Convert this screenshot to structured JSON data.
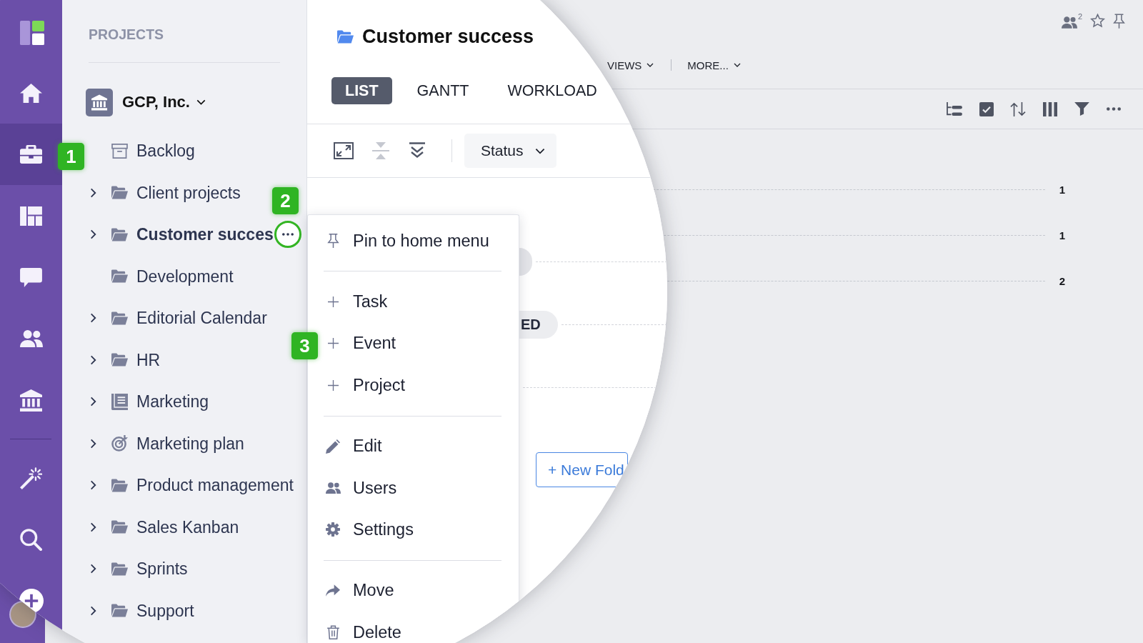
{
  "sidebar": {
    "items": [
      {
        "kind": "home",
        "selected": false
      },
      {
        "kind": "projects",
        "selected": true,
        "callout": "1"
      },
      {
        "kind": "dashboards",
        "selected": false
      },
      {
        "kind": "inbox",
        "selected": false
      },
      {
        "kind": "users",
        "selected": false
      },
      {
        "kind": "accounts",
        "selected": false
      }
    ],
    "tools": [
      {
        "kind": "wand",
        "selected": false
      },
      {
        "kind": "search",
        "selected": false
      },
      {
        "kind": "create",
        "selected": false
      }
    ]
  },
  "projects": {
    "title": "PROJECTS",
    "account": {
      "name": "GCP, Inc."
    },
    "items": [
      {
        "label": "Backlog",
        "kind": "box",
        "has_children": false,
        "selected": false
      },
      {
        "label": "Client projects",
        "kind": "folder",
        "has_children": true,
        "selected": false
      },
      {
        "label": "Customer succes",
        "kind": "folder",
        "has_children": true,
        "selected": true,
        "more_button": {
          "highlighted": true,
          "callout": "2"
        }
      },
      {
        "label": "Development",
        "kind": "folder",
        "has_children": false,
        "selected": false
      },
      {
        "label": "Editorial Calendar",
        "kind": "folder",
        "has_children": true,
        "selected": false
      },
      {
        "label": "HR",
        "kind": "folder",
        "has_children": true,
        "selected": false
      },
      {
        "label": "Marketing",
        "kind": "sheet",
        "has_children": true,
        "selected": false
      },
      {
        "label": "Marketing plan",
        "kind": "target",
        "has_children": true,
        "selected": false
      },
      {
        "label": "Product management",
        "kind": "folder",
        "has_children": true,
        "selected": false
      },
      {
        "label": "Sales Kanban",
        "kind": "folder",
        "has_children": true,
        "selected": false
      },
      {
        "label": "Sprints",
        "kind": "folder",
        "has_children": true,
        "selected": false
      },
      {
        "label": "Support",
        "kind": "folder",
        "has_children": true,
        "selected": false
      }
    ]
  },
  "content": {
    "title": "Customer success",
    "tabs": [
      {
        "label": "LIST",
        "selected": true
      },
      {
        "label": "GANTT",
        "selected": false
      },
      {
        "label": "WORKLOAD",
        "selected": false
      }
    ],
    "tools": [
      {
        "kind": "expand",
        "disabled": false
      },
      {
        "kind": "collapse",
        "disabled": true
      },
      {
        "kind": "expand_all",
        "disabled": false
      }
    ],
    "group_by": {
      "label": "Status"
    },
    "groups": [
      {
        "kind": "pill"
      },
      {
        "kind": "pill",
        "label": "ED"
      },
      {
        "kind": "line"
      }
    ],
    "new_folder_button": {
      "label": "+ New Fold"
    }
  },
  "context_menu": {
    "sections": [
      [
        {
          "kind": "pin",
          "label": "Pin to home menu"
        }
      ],
      [
        {
          "kind": "plus",
          "label": "Task"
        },
        {
          "kind": "plus",
          "label": "Event",
          "callout": "3"
        },
        {
          "kind": "plus",
          "label": "Project"
        }
      ],
      [
        {
          "kind": "pencil",
          "label": "Edit"
        },
        {
          "kind": "users",
          "label": "Users"
        },
        {
          "kind": "gear",
          "label": "Settings"
        }
      ],
      [
        {
          "kind": "move",
          "label": "Move"
        },
        {
          "kind": "trash",
          "label": "Delete"
        }
      ]
    ]
  },
  "background": {
    "header_actions": [
      {
        "kind": "members",
        "count": "2"
      },
      {
        "kind": "star"
      },
      {
        "kind": "pin"
      }
    ],
    "menus": [
      {
        "label": "VIEWS"
      },
      {
        "label": "MORE..."
      }
    ],
    "toolbar": [
      {
        "kind": "tree"
      },
      {
        "kind": "check"
      },
      {
        "kind": "sort"
      },
      {
        "kind": "columns"
      },
      {
        "kind": "filter"
      },
      {
        "kind": "more"
      }
    ],
    "row_counts": [
      "1",
      "1",
      "2"
    ]
  }
}
